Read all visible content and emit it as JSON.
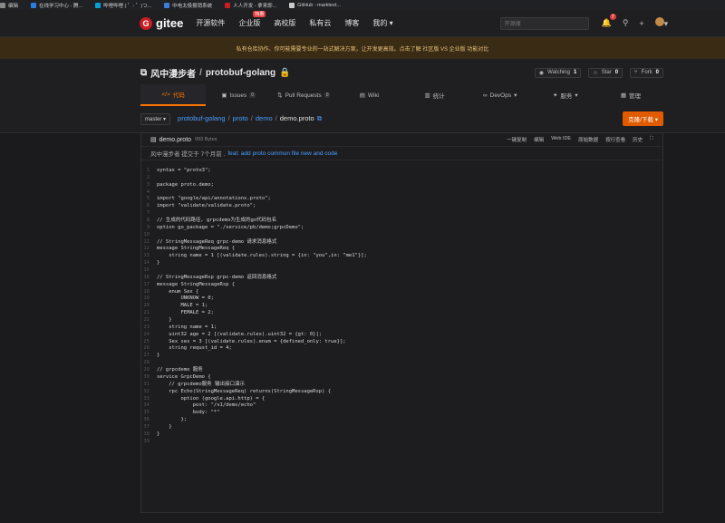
{
  "bookmarks": [
    {
      "label": "编辑",
      "color": "#888"
    },
    {
      "label": "在线学习中心 - 腾...",
      "color": "#2a7de1"
    },
    {
      "label": "哔哩哔哩 ( ゜- ゜)つ...",
      "color": "#00a1d6"
    },
    {
      "label": "中电太极报销系统",
      "color": "#3b7dd8"
    },
    {
      "label": "人人开发 - 拿来即...",
      "color": "#c71d23"
    },
    {
      "label": "GitHub - marktext...",
      "color": "#cccccc"
    }
  ],
  "nav": {
    "logo_text": "gitee",
    "items": [
      "开源软件",
      "企业版",
      "高校版",
      "私有云",
      "博客"
    ],
    "ent_badge": "特惠",
    "my": "我的",
    "search_placeholder": "开源搜",
    "notif_count": "7"
  },
  "banner": "私有仓库协作、你可能需要专业的一站式解决方案，让开发更高效。点击了解 社区版 VS 企业版 功能对比",
  "repo": {
    "owner": "风中漫步者",
    "name": "protobuf-golang",
    "watch_label": "Watching",
    "watch_count": "1",
    "star_label": "Star",
    "star_count": "0",
    "fork_label": "Fork",
    "fork_count": "0"
  },
  "tabs": [
    {
      "label": "代码",
      "icon": "</>",
      "count": ""
    },
    {
      "label": "Issues",
      "icon": "▣",
      "count": "0"
    },
    {
      "label": "Pull Requests",
      "icon": "⇅",
      "count": "0"
    },
    {
      "label": "Wiki",
      "icon": "▤",
      "count": ""
    },
    {
      "label": "统计",
      "icon": "▥",
      "count": ""
    },
    {
      "label": "DevOps",
      "icon": "∞",
      "count": "▾"
    },
    {
      "label": "服务",
      "icon": "✦",
      "count": "▾"
    },
    {
      "label": "管理",
      "icon": "▦",
      "count": ""
    }
  ],
  "path": {
    "branch": "master",
    "crumbs": [
      "protobuf-golang",
      "proto",
      "demo"
    ],
    "file": "demo.proto",
    "clone": "克隆/下载"
  },
  "file": {
    "name": "demo.proto",
    "size": "993 Bytes",
    "actions": [
      "一键复制",
      "编辑",
      "Web IDE",
      "原始数据",
      "按行查看",
      "历史"
    ],
    "commit_author": "风中漫步者 提交于 7个月前 .",
    "commit_msg": "feat: add proto common file new and code"
  },
  "code": [
    {
      "n": "1",
      "t": "syntax = \"proto3\";"
    },
    {
      "n": "2",
      "t": ""
    },
    {
      "n": "3",
      "t": "package proto.demo;"
    },
    {
      "n": "4",
      "t": ""
    },
    {
      "n": "5",
      "t": "import \"google/api/annotations.proto\";"
    },
    {
      "n": "6",
      "t": "import \"validate/validate.proto\";"
    },
    {
      "n": "7",
      "t": ""
    },
    {
      "n": "8",
      "t": "// 生成的代码路径, grpcdemo为生成的go代码包名"
    },
    {
      "n": "9",
      "t": "option go_package = \"./service/pb/demo;grpcDemo\";"
    },
    {
      "n": "10",
      "t": ""
    },
    {
      "n": "11",
      "t": "// StringMessageReq grpc-demo 请求消息格式"
    },
    {
      "n": "12",
      "t": "message StringMessageReq {"
    },
    {
      "n": "13",
      "t": "    string name = 1 [(validate.rules).string = {in: \"you\",in: \"me1\"}];"
    },
    {
      "n": "14",
      "t": "}"
    },
    {
      "n": "15",
      "t": ""
    },
    {
      "n": "16",
      "t": "// StringMessageRsp grpc-demo 返回消息格式"
    },
    {
      "n": "17",
      "t": "message StringMessageRsp {"
    },
    {
      "n": "18",
      "t": "    enum Sex {"
    },
    {
      "n": "19",
      "t": "        UNKNOW = 0;"
    },
    {
      "n": "20",
      "t": "        MALE = 1;"
    },
    {
      "n": "21",
      "t": "        FEMALE = 2;"
    },
    {
      "n": "22",
      "t": "    }"
    },
    {
      "n": "23",
      "t": "    string name = 1;"
    },
    {
      "n": "24",
      "t": "    uint32 age = 2 [(validate.rules).uint32 = {gt: 0}];"
    },
    {
      "n": "25",
      "t": "    Sex sex = 3 [(validate.rules).enum = {defined_only: true}];"
    },
    {
      "n": "26",
      "t": "    string requst_id = 4;"
    },
    {
      "n": "27",
      "t": "}"
    },
    {
      "n": "28",
      "t": ""
    },
    {
      "n": "29",
      "t": "// grpcdemo 服务"
    },
    {
      "n": "30",
      "t": "service GrpcDemo {"
    },
    {
      "n": "31",
      "t": "    // grpcdemo服务 输出接口演示"
    },
    {
      "n": "32",
      "t": "    rpc Echo(StringMessageReq) returns(StringMessageRsp) {"
    },
    {
      "n": "33",
      "t": "        option (google.api.http) = {"
    },
    {
      "n": "34",
      "t": "            post: \"/v1/demo/echo\""
    },
    {
      "n": "35",
      "t": "            body: \"*\""
    },
    {
      "n": "36",
      "t": "        };"
    },
    {
      "n": "37",
      "t": "    }"
    },
    {
      "n": "38",
      "t": "}"
    },
    {
      "n": "39",
      "t": ""
    }
  ]
}
